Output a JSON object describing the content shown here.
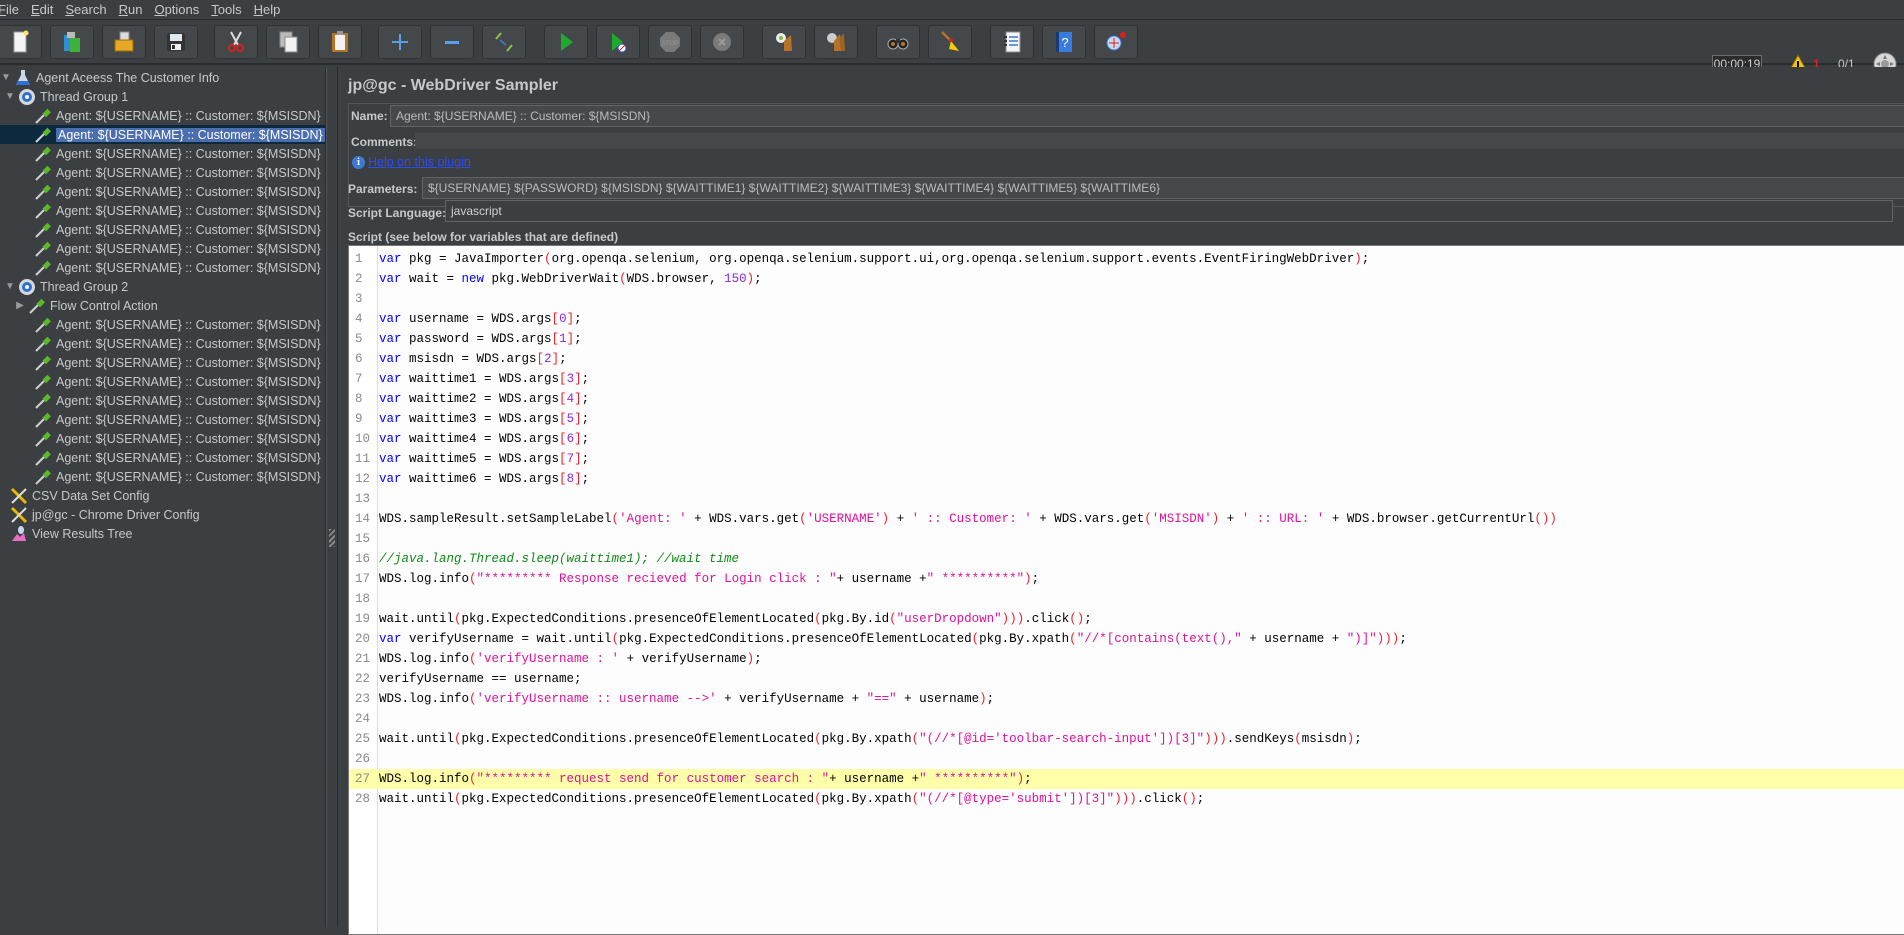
{
  "menu": [
    {
      "label": "File",
      "mnemonic": "F"
    },
    {
      "label": "Edit",
      "mnemonic": "E"
    },
    {
      "label": "Search",
      "mnemonic": "S"
    },
    {
      "label": "Run",
      "mnemonic": "R"
    },
    {
      "label": "Options",
      "mnemonic": "O"
    },
    {
      "label": "Tools",
      "mnemonic": "T"
    },
    {
      "label": "Help",
      "mnemonic": "H"
    }
  ],
  "toolbar": {
    "buttons": [
      {
        "name": "new-icon",
        "tooltip": "New"
      },
      {
        "name": "templates-icon",
        "tooltip": "Templates"
      },
      {
        "name": "open-icon",
        "tooltip": "Open"
      },
      {
        "name": "save-icon",
        "tooltip": "Save"
      },
      {
        "name": "cut-icon",
        "tooltip": "Cut"
      },
      {
        "name": "copy-icon",
        "tooltip": "Copy"
      },
      {
        "name": "paste-icon",
        "tooltip": "Paste"
      },
      {
        "name": "expand-icon",
        "tooltip": "Expand All"
      },
      {
        "name": "collapse-icon",
        "tooltip": "Collapse All"
      },
      {
        "name": "toggle-icon",
        "tooltip": "Toggle"
      },
      {
        "name": "start-icon",
        "tooltip": "Start"
      },
      {
        "name": "start-no-pauses-icon",
        "tooltip": "Start no pauses"
      },
      {
        "name": "stop-icon",
        "tooltip": "Stop"
      },
      {
        "name": "shutdown-icon",
        "tooltip": "Shutdown"
      },
      {
        "name": "clear-icon",
        "tooltip": "Clear"
      },
      {
        "name": "clear-all-icon",
        "tooltip": "Clear All"
      },
      {
        "name": "search-icon",
        "tooltip": "Search"
      },
      {
        "name": "reset-search-icon",
        "tooltip": "Reset Search"
      },
      {
        "name": "function-helper-icon",
        "tooltip": "Function Helper Dialog"
      },
      {
        "name": "help-icon",
        "tooltip": "Help"
      },
      {
        "name": "plugins-manager-icon",
        "tooltip": "Plugins Manager"
      }
    ],
    "elapsed_time": "00:00:19",
    "warning_count": "1",
    "active_threads": "0/1"
  },
  "tree": {
    "items": [
      {
        "label": "Agent Aceess The Customer Info",
        "type": "test-plan",
        "level": 0,
        "expanded": true
      },
      {
        "label": "Thread Group 1",
        "type": "thread-group",
        "level": 1,
        "expanded": true
      },
      {
        "label": "Agent: ${USERNAME} :: Customer: ${MSISDN}",
        "type": "sampler",
        "level": 2
      },
      {
        "label": "Agent: ${USERNAME} :: Customer: ${MSISDN}",
        "type": "sampler",
        "level": 2,
        "selected": true
      },
      {
        "label": "Agent: ${USERNAME} :: Customer: ${MSISDN}",
        "type": "sampler",
        "level": 2
      },
      {
        "label": "Agent: ${USERNAME} :: Customer: ${MSISDN}",
        "type": "sampler",
        "level": 2
      },
      {
        "label": "Agent: ${USERNAME} :: Customer: ${MSISDN}",
        "type": "sampler",
        "level": 2
      },
      {
        "label": "Agent: ${USERNAME} :: Customer: ${MSISDN}",
        "type": "sampler",
        "level": 2
      },
      {
        "label": "Agent: ${USERNAME} :: Customer: ${MSISDN}",
        "type": "sampler",
        "level": 2
      },
      {
        "label": "Agent: ${USERNAME} :: Customer: ${MSISDN}",
        "type": "sampler",
        "level": 2
      },
      {
        "label": "Agent: ${USERNAME} :: Customer: ${MSISDN}",
        "type": "sampler",
        "level": 2
      },
      {
        "label": "Thread Group 2",
        "type": "thread-group",
        "level": 1,
        "expanded": true
      },
      {
        "label": "Flow Control Action",
        "type": "sampler",
        "level": 2,
        "collapsed": true
      },
      {
        "label": "Agent: ${USERNAME} :: Customer: ${MSISDN}",
        "type": "sampler",
        "level": 2
      },
      {
        "label": "Agent: ${USERNAME} :: Customer: ${MSISDN}",
        "type": "sampler",
        "level": 2
      },
      {
        "label": "Agent: ${USERNAME} :: Customer: ${MSISDN}",
        "type": "sampler",
        "level": 2
      },
      {
        "label": "Agent: ${USERNAME} :: Customer: ${MSISDN}",
        "type": "sampler",
        "level": 2
      },
      {
        "label": "Agent: ${USERNAME} :: Customer: ${MSISDN}",
        "type": "sampler",
        "level": 2
      },
      {
        "label": "Agent: ${USERNAME} :: Customer: ${MSISDN}",
        "type": "sampler",
        "level": 2
      },
      {
        "label": "Agent: ${USERNAME} :: Customer: ${MSISDN}",
        "type": "sampler",
        "level": 2
      },
      {
        "label": "Agent: ${USERNAME} :: Customer: ${MSISDN}",
        "type": "sampler",
        "level": 2
      },
      {
        "label": "Agent: ${USERNAME} :: Customer: ${MSISDN}",
        "type": "sampler",
        "level": 2
      },
      {
        "label": "CSV Data Set Config",
        "type": "config",
        "level": 1
      },
      {
        "label": "jp@gc - Chrome Driver Config",
        "type": "config",
        "level": 1
      },
      {
        "label": "View Results Tree",
        "type": "listener",
        "level": 1
      }
    ]
  },
  "panel": {
    "title": "jp@gc - WebDriver Sampler",
    "name_label": "Name:",
    "name_value": "Agent: ${USERNAME} :: Customer: ${MSISDN}",
    "comments_label": "Comments:",
    "comments_value": "",
    "help_link": "Help on this plugin",
    "parameters_label": "Parameters:",
    "parameters_value": "${USERNAME} ${PASSWORD} ${MSISDN} ${WAITTIME1} ${WAITTIME2} ${WAITTIME3} ${WAITTIME4} ${WAITTIME5} ${WAITTIME6}",
    "script_language_label": "Script Language:",
    "script_language_value": "javascript",
    "script_label": "Script (see below for variables that are defined)"
  },
  "editor": {
    "highlighted_line": 27,
    "lines": [
      "var pkg = JavaImporter(org.openqa.selenium, org.openqa.selenium.support.ui,org.openqa.selenium.support.events.EventFiringWebDriver);",
      "var wait = new pkg.WebDriverWait(WDS.browser, 150);",
      "",
      "var username = WDS.args[0];",
      "var password = WDS.args[1];",
      "var msisdn = WDS.args[2];",
      "var waittime1 = WDS.args[3];",
      "var waittime2 = WDS.args[4];",
      "var waittime3 = WDS.args[5];",
      "var waittime4 = WDS.args[6];",
      "var waittime5 = WDS.args[7];",
      "var waittime6 = WDS.args[8];",
      "",
      "WDS.sampleResult.setSampleLabel('Agent: ' + WDS.vars.get('USERNAME') + ' :: Customer: ' + WDS.vars.get('MSISDN') + ' :: URL: ' + WDS.browser.getCurrentUrl())",
      "",
      "//java.lang.Thread.sleep(waittime1); //wait time",
      "WDS.log.info(\"********* Response recieved for Login click : \"+ username +\" **********\");",
      "",
      "wait.until(pkg.ExpectedConditions.presenceOfElementLocated(pkg.By.id(\"userDropdown\"))).click();",
      "var verifyUsername = wait.until(pkg.ExpectedConditions.presenceOfElementLocated(pkg.By.xpath(\"//*[contains(text(),\" + username + \")]\")));",
      "WDS.log.info('verifyUsername : ' + verifyUsername);",
      "verifyUsername == username;",
      "WDS.log.info('verifyUsername :: username -->' + verifyUsername + \"==\" + username);",
      "",
      "wait.until(pkg.ExpectedConditions.presenceOfElementLocated(pkg.By.xpath(\"(//*[@id='toolbar-search-input'])[3]\"))).sendKeys(msisdn);",
      "",
      "WDS.log.info(\"********* request send for customer search : \"+ username +\" **********\");",
      "wait.until(pkg.ExpectedConditions.presenceOfElementLocated(pkg.By.xpath(\"(//*[@type='submit'])[3]\"))).click();"
    ]
  },
  "colors": {
    "background": "#3c3f41",
    "selection": "#4b6eaf",
    "editor_highlight": "#ffffaa",
    "keyword": "#0000ff",
    "string": "#e0119a",
    "number": "#8c2bd9",
    "comment": "#0e8a16",
    "warning": "#e02020"
  }
}
